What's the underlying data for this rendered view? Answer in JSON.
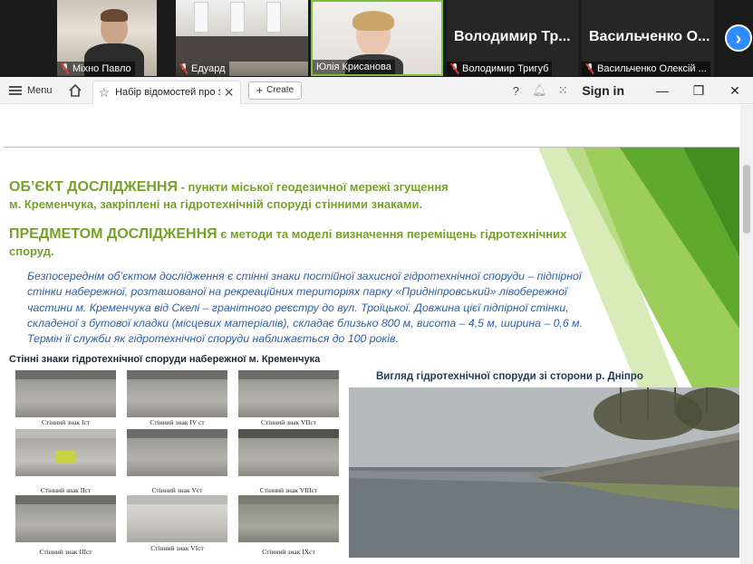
{
  "participants": [
    {
      "name": "Міхно Павло",
      "muted": true
    },
    {
      "name": "Едуард",
      "muted": true
    },
    {
      "name": "Юлія Крисанова",
      "muted": false
    },
    {
      "name": "Володимир Тригуб",
      "muted": true,
      "display": "Володимир Тр..."
    },
    {
      "name": "Васильченко Олексій ...",
      "muted": true,
      "display": "Васильченко О..."
    }
  ],
  "next_icon": "chevron-right-icon",
  "browser": {
    "menu_label": "Menu",
    "tab_title": "Набір відомостей про з...",
    "create_label": "Create",
    "signin_label": "Sign in"
  },
  "slide": {
    "object_title": "ОБ’ЄКТ ДОСЛІДЖЕННЯ",
    "object_rest": " - пункти міської геодезичної мережі згущення",
    "object_line2": "м. Кременчука, закріплені на гідротехнічній споруді стінними знаками.",
    "subject_title": "ПРЕДМЕТОМ ДОСЛІДЖЕННЯ",
    "subject_rest": " є методи та моделі визначення переміщень гідротехнічних",
    "subject_line2": "споруд.",
    "description_lines": [
      "Безпосереднім об’єктом дослідження є стінні знаки постійної захисної гідротехнічної споруди – підпірної",
      "стінки набережної, розташованої на рекреаційних територіях парку «Придніпровський» лівобережної",
      "частини м. Кременчука від Скелі – гранітного реєстру до вул. Троїцької. Довжина цієї підпірної стінки,",
      "складеної з бутової кладки (місцевих матеріалів), складає близько 800 м, висота – 4,5 м, ширина – 0,6 м.",
      "Термін її служби як гідротехнічної споруди наближається до 100 років."
    ],
    "left_caption": "Стінні знаки гідротехнічної споруди набережної м. Кременчука",
    "right_caption": "Вигляд гідротехнічної споруди зі сторони р. Дніпро",
    "photo_captions": [
      "Стінний знак Іст",
      "Стінний знак IV ст",
      "Стінний знак VІІст",
      "Стінний знак  ІІст",
      "Стінний знак Vст",
      "Стінний знак VІІІст",
      "Стінний знак  ІІІст",
      "Стінний знак VІст",
      "Стінний знак  ІХст"
    ]
  },
  "colors": {
    "accent_green": "#76a22a",
    "text_blue": "#2e5ea8",
    "zoom_blue": "#2d8cff"
  }
}
